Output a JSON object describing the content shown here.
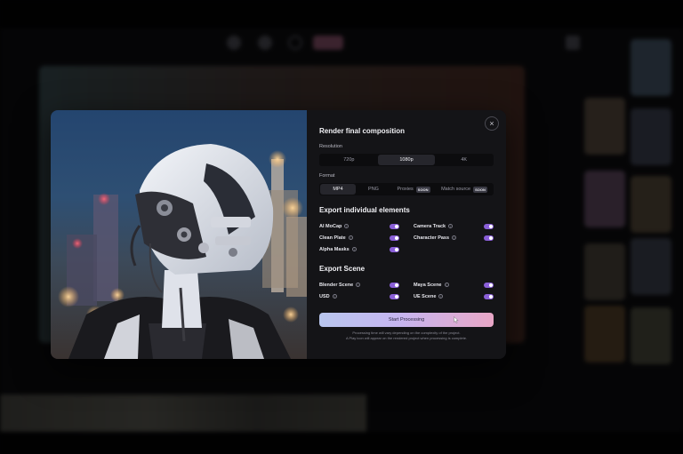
{
  "modal": {
    "title": "Render final composition",
    "close_icon": "×",
    "resolution": {
      "label": "Resolution",
      "options": [
        "720p",
        "1080p",
        "4K"
      ],
      "selected": "1080p"
    },
    "format": {
      "label": "Format",
      "options": [
        {
          "label": "MP4",
          "badge": ""
        },
        {
          "label": "PNG",
          "badge": ""
        },
        {
          "label": "Proxies",
          "badge": "SOON"
        },
        {
          "label": "Match source",
          "badge": "SOON"
        }
      ],
      "selected": "MP4"
    },
    "export_elements": {
      "title": "Export individual elements",
      "items": [
        {
          "label": "AI MoCap",
          "enabled": true
        },
        {
          "label": "Camera Track",
          "enabled": true
        },
        {
          "label": "Clean Plate",
          "enabled": true
        },
        {
          "label": "Character Pass",
          "enabled": true
        },
        {
          "label": "Alpha Masks",
          "enabled": true
        }
      ]
    },
    "export_scene": {
      "title": "Export Scene",
      "items": [
        {
          "label": "Blender Scene",
          "enabled": true
        },
        {
          "label": "Maya Scene",
          "enabled": true
        },
        {
          "label": "USD",
          "enabled": true
        },
        {
          "label": "UE Scene",
          "enabled": true
        }
      ]
    },
    "start_button": "Start Processing",
    "note_line1": "Processing time will vary depending on the complexity of the project.",
    "note_line2": "A Play icon will appear on the rendered project when processing is complete."
  },
  "colors": {
    "toggle_on": "#8a5fd8",
    "button_gradient": [
      "#b9c6ee",
      "#c6b6f0",
      "#e8a6c6"
    ],
    "panel_bg": "#141417"
  },
  "icons": {
    "close": "close-icon",
    "info": "info-icon",
    "cursor": "pointer-cursor-icon"
  }
}
